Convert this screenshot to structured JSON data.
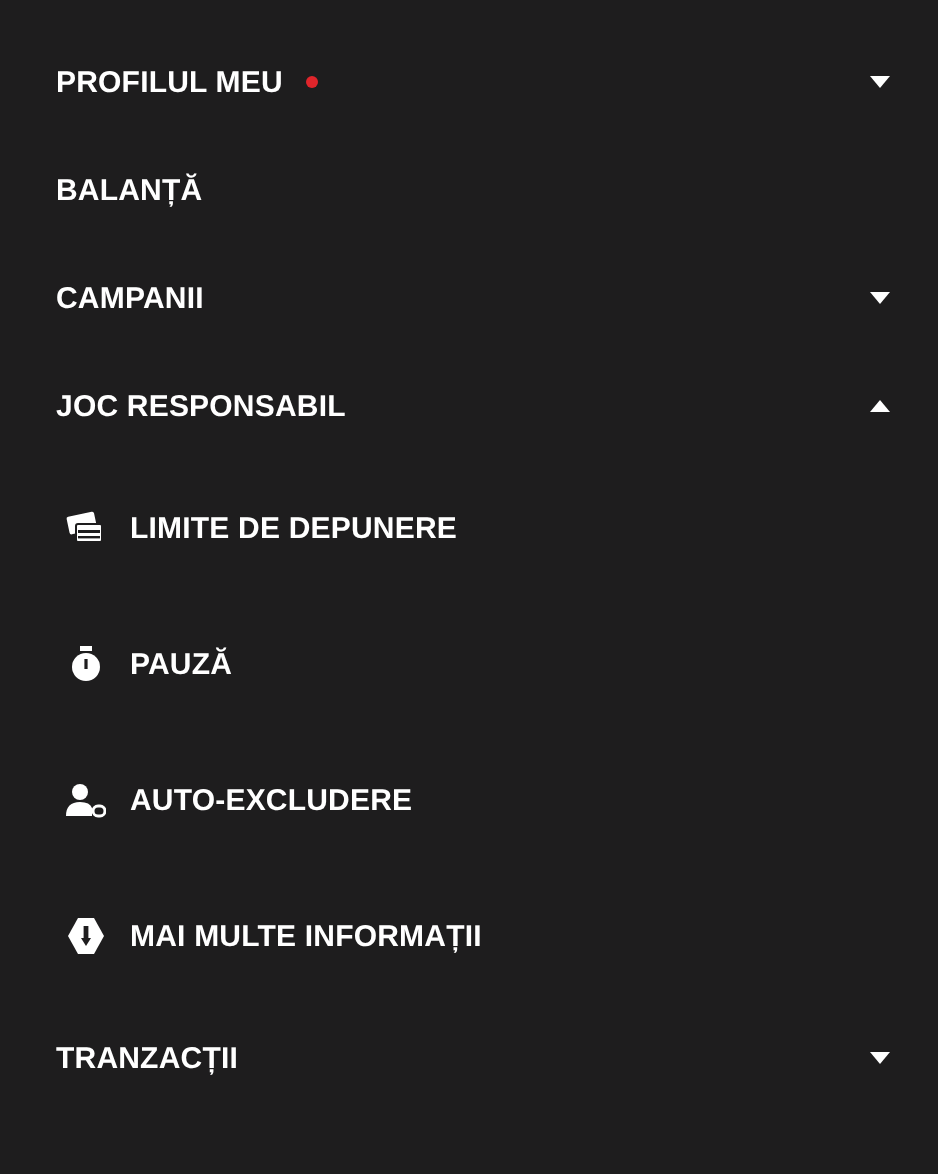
{
  "menu": [
    {
      "kind": "group",
      "label": "PROFILUL MEU",
      "notification": true,
      "expanded": false
    },
    {
      "kind": "link",
      "label": "BALANȚĂ",
      "notification": false
    },
    {
      "kind": "group",
      "label": "CAMPANII",
      "notification": false,
      "expanded": false
    },
    {
      "kind": "group",
      "label": "JOC RESPONSABIL",
      "notification": false,
      "expanded": true,
      "children": [
        {
          "kind": "deposit",
          "label": "LIMITE DE DEPUNERE"
        },
        {
          "kind": "timer",
          "label": "PAUZĂ"
        },
        {
          "kind": "user",
          "label": "AUTO-EXCLUDERE"
        },
        {
          "kind": "info",
          "label": "MAI MULTE INFORMAȚII"
        }
      ]
    },
    {
      "kind": "group",
      "label": "TRANZACȚII",
      "notification": false,
      "expanded": false
    }
  ]
}
